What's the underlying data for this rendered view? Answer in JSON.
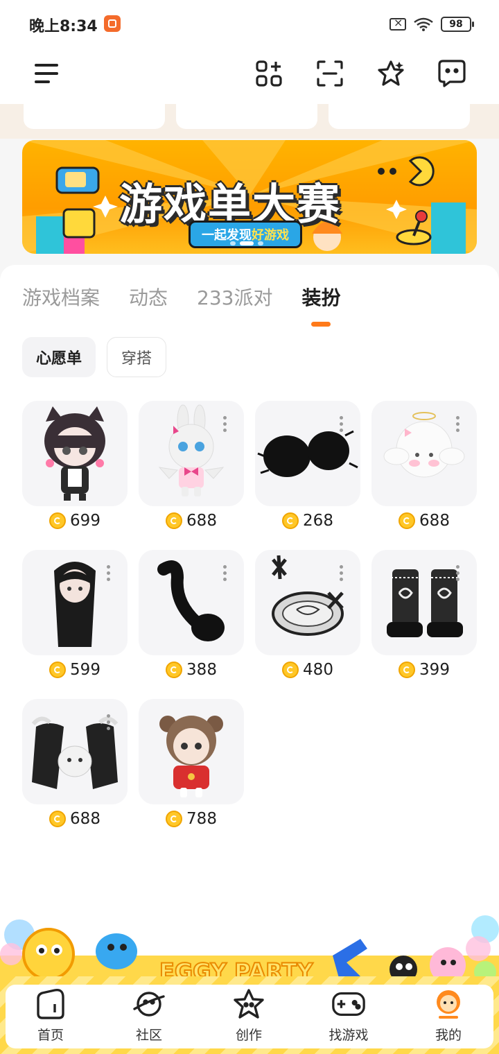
{
  "status": {
    "time": "晚上8:34",
    "battery": "98"
  },
  "tabs": [
    "游戏档案",
    "动态",
    "233派对",
    "装扮"
  ],
  "chips": {
    "wishlist": "心愿单",
    "outfits": "穿搭"
  },
  "banner": {
    "title": "游戏单大赛",
    "subtitle_prefix": "一起发现",
    "subtitle_highlight": "好游戏"
  },
  "items": [
    {
      "price": "699",
      "name": "cat-ear-girl"
    },
    {
      "price": "688",
      "name": "bunny-angel"
    },
    {
      "price": "268",
      "name": "black-fur-muffs"
    },
    {
      "price": "688",
      "name": "cinnamoroll-hat"
    },
    {
      "price": "599",
      "name": "long-black-hair"
    },
    {
      "price": "388",
      "name": "black-tail"
    },
    {
      "price": "480",
      "name": "cross-halo"
    },
    {
      "price": "399",
      "name": "heart-boots"
    },
    {
      "price": "688",
      "name": "bunny-sleeves"
    },
    {
      "price": "788",
      "name": "red-dress-doll"
    }
  ],
  "promo": {
    "text": "EGGY PARTY"
  },
  "nav": [
    {
      "label": "首页",
      "icon": "home-icon"
    },
    {
      "label": "社区",
      "icon": "planet-icon"
    },
    {
      "label": "创作",
      "icon": "star-create-icon"
    },
    {
      "label": "找游戏",
      "icon": "gamepad-icon"
    },
    {
      "label": "我的",
      "icon": "profile-icon"
    }
  ],
  "colors": {
    "accent": "#ff7a1a",
    "coin": "#ffc727",
    "banner": "#ffb300"
  }
}
